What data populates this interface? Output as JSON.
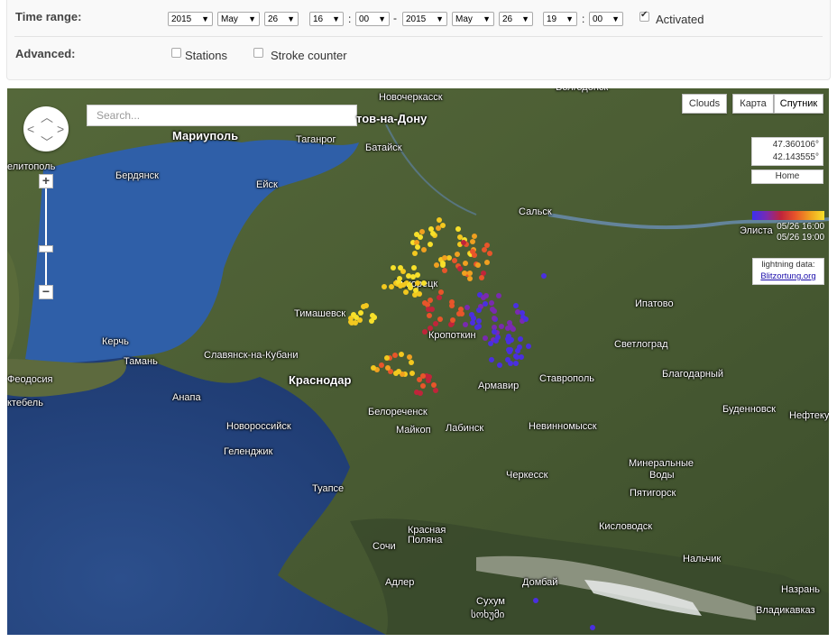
{
  "controls": {
    "time_range_label": "Time range:",
    "advanced_label": "Advanced:",
    "start": {
      "year": "2015",
      "month": "May",
      "day": "26",
      "hour": "16",
      "minute": "00"
    },
    "end": {
      "year": "2015",
      "month": "May",
      "day": "26",
      "hour": "19",
      "minute": "00"
    },
    "colon": ":",
    "dash": "-",
    "activated_label": "Activated",
    "activated_checked": true,
    "stations_label": "Stations",
    "stations_checked": false,
    "stroke_counter_label": "Stroke counter",
    "stroke_counter_checked": false,
    "dropdown_arrow": "▼"
  },
  "map": {
    "search_placeholder": "Search...",
    "clouds_button": "Clouds",
    "map_type_buttons": [
      "Карта",
      "Спутник"
    ],
    "active_map_type": "Спутник",
    "coords": {
      "lat": "47.360106°",
      "lon": "42.143555°"
    },
    "home_button": "Home",
    "legend": {
      "from": "05/26 16:00",
      "to": "05/26 19:00"
    },
    "credit": {
      "title": "lightning data:",
      "link": "Blitzortung.org"
    },
    "zoom_in": "+",
    "zoom_out": "−",
    "cities": [
      {
        "name": "Новочеркасск",
        "big": false
      },
      {
        "name": "Волгодонск",
        "big": false
      },
      {
        "name": "тов-на-Дону",
        "big": true
      },
      {
        "name": "Мариуполь",
        "big": true
      },
      {
        "name": "Таганрог",
        "big": false
      },
      {
        "name": "Батайск",
        "big": false
      },
      {
        "name": "елитополь",
        "big": false
      },
      {
        "name": "Бердянск",
        "big": false
      },
      {
        "name": "Ейск",
        "big": false
      },
      {
        "name": "Сальск",
        "big": false
      },
      {
        "name": "Элиста",
        "big": false
      },
      {
        "name": "Тихорецк",
        "big": false
      },
      {
        "name": "Тимашевск",
        "big": false
      },
      {
        "name": "Ипатово",
        "big": false
      },
      {
        "name": "Кропоткин",
        "big": false
      },
      {
        "name": "Керчь",
        "big": false
      },
      {
        "name": "Тамань",
        "big": false
      },
      {
        "name": "Славянск-на-Кубани",
        "big": false
      },
      {
        "name": "Светлоград",
        "big": false
      },
      {
        "name": "Благодарный",
        "big": false
      },
      {
        "name": "Феодосия",
        "big": false
      },
      {
        "name": "Анапа",
        "big": false
      },
      {
        "name": "Краснодар",
        "big": true
      },
      {
        "name": "Армавир",
        "big": false
      },
      {
        "name": "Ставрополь",
        "big": false
      },
      {
        "name": "Буденновск",
        "big": false
      },
      {
        "name": "Нефтекумск",
        "big": false
      },
      {
        "name": "ктебель",
        "big": false
      },
      {
        "name": "Новороссийск",
        "big": false
      },
      {
        "name": "Белореченск",
        "big": false
      },
      {
        "name": "Майкоп",
        "big": false
      },
      {
        "name": "Лабинск",
        "big": false
      },
      {
        "name": "Невинномысск",
        "big": false
      },
      {
        "name": "Геленджик",
        "big": false
      },
      {
        "name": "Черкесск",
        "big": false
      },
      {
        "name": "Минеральные",
        "big": false
      },
      {
        "name": "Воды",
        "big": false
      },
      {
        "name": "Пятигорск",
        "big": false
      },
      {
        "name": "Туапсе",
        "big": false
      },
      {
        "name": "Кисловодск",
        "big": false
      },
      {
        "name": "Красная",
        "big": false
      },
      {
        "name": "Поляна",
        "big": false
      },
      {
        "name": "Сочи",
        "big": false
      },
      {
        "name": "Нальчик",
        "big": false
      },
      {
        "name": "Адлер",
        "big": false
      },
      {
        "name": "Домбай",
        "big": false
      },
      {
        "name": "Назрань",
        "big": false
      },
      {
        "name": "Сухум",
        "big": false
      },
      {
        "name": "Владикавказ",
        "big": false
      },
      {
        "name": "სოხუმი",
        "big": false
      }
    ]
  }
}
